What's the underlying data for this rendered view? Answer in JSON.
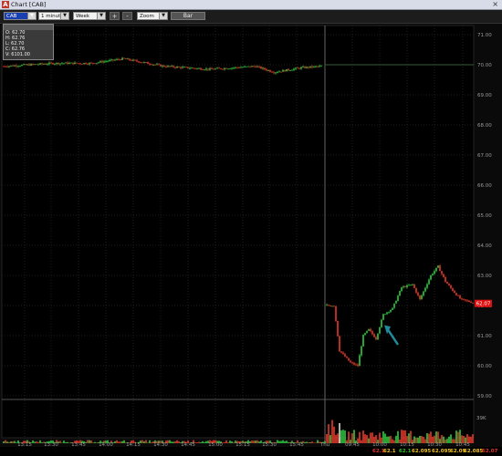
{
  "window": {
    "title": "Chart [CAB]",
    "close": "×",
    "app_icon": "A"
  },
  "toolbar": {
    "symbol": "CAB",
    "interval": "1 minute",
    "range": "Week",
    "zoom_in": "+",
    "zoom_out": "-",
    "zoom": "Zoom",
    "bar": "Bar"
  },
  "ohlc_box": {
    "header": "",
    "open": "O: 62.70",
    "high": "H: 62.76",
    "low": "L: 62.70",
    "close": "C: 62.76",
    "volume": "V: 6101.00"
  },
  "price_axis": [
    "71.00",
    "70.00",
    "69.00",
    "68.00",
    "67.00",
    "66.00",
    "65.00",
    "64.00",
    "63.00",
    "62.00",
    "61.00",
    "60.00",
    "59.00"
  ],
  "last_price_tag": "62.07",
  "volume_axis": "39K",
  "time_axis": [
    "13:15",
    "13:30",
    "13:45",
    "14:00",
    "14:15",
    "14:30",
    "14:45",
    "15:00",
    "15:15",
    "15:30",
    "15:45",
    "Thu",
    "09:45",
    "10:00",
    "10:15",
    "10:30",
    "10:45"
  ],
  "status": [
    {
      "text": "62.1",
      "color": "#e03030"
    },
    {
      "text": "62.1",
      "color": "#f0c020"
    },
    {
      "text": "62.1",
      "color": "#30c030"
    },
    {
      "text": "62.095",
      "color": "#f0c020"
    },
    {
      "text": "62.095",
      "color": "#f0c020"
    },
    {
      "text": "62.09",
      "color": "#f0c020"
    },
    {
      "text": "62.085",
      "color": "#f0c020"
    },
    {
      "text": "62.07",
      "color": "#e03030"
    }
  ],
  "colors": {
    "up": "#2ecc40",
    "down": "#e8392b",
    "grid": "#1e1e1e",
    "axis_text": "#9a9a9a",
    "arrow": "#1f8a9a",
    "tag": "#e01010"
  }
}
